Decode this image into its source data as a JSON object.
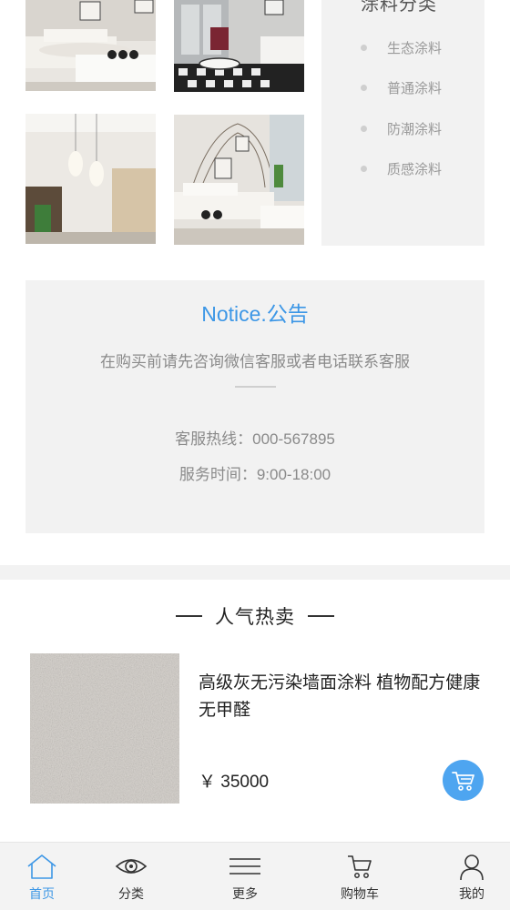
{
  "gallery": {
    "images": [
      "living-room-photo",
      "living-room-photo",
      "living-room-photo",
      "living-room-photo"
    ]
  },
  "category": {
    "title": "涂料分类",
    "items": [
      "生态涂料",
      "普通涂料",
      "防潮涂料",
      "质感涂料"
    ]
  },
  "notice": {
    "title": "Notice.公告",
    "text": "在购买前请先咨询微信客服或者电话联系客服",
    "hotline": "客服热线：000-567895",
    "hours": "服务时间：9:00-18:00"
  },
  "hot": {
    "title": "人气热卖",
    "product": {
      "name": "高级灰无污染墙面涂料 植物配方健康无甲醛",
      "price": "￥ 35000",
      "cart_icon": "cart-icon"
    }
  },
  "tabbar": {
    "items": [
      {
        "label": "首页",
        "icon": "home-icon",
        "active": true
      },
      {
        "label": "分类",
        "icon": "eye-icon",
        "active": false
      },
      {
        "label": "更多",
        "icon": "menu-icon",
        "active": false
      },
      {
        "label": "购物车",
        "icon": "cart-icon",
        "active": false
      },
      {
        "label": "我的",
        "icon": "user-icon",
        "active": false
      }
    ]
  },
  "colors": {
    "accent": "#3d97e6",
    "cart_button": "#4ea5f0",
    "panel_bg": "#f2f2f2"
  }
}
